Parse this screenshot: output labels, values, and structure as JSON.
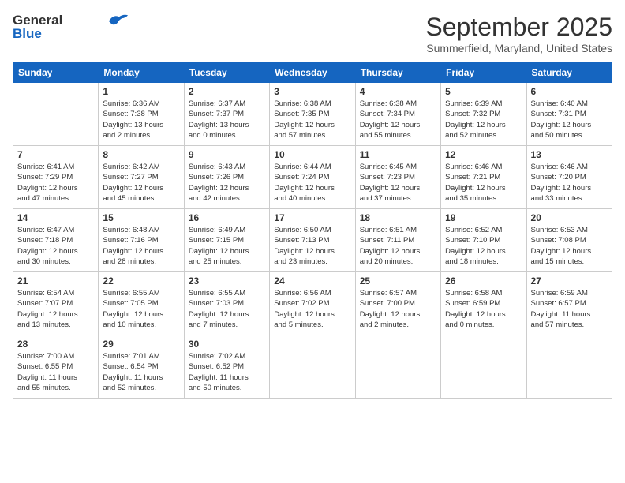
{
  "header": {
    "logo_line1": "General",
    "logo_line2": "Blue",
    "month": "September 2025",
    "location": "Summerfield, Maryland, United States"
  },
  "days_of_week": [
    "Sunday",
    "Monday",
    "Tuesday",
    "Wednesday",
    "Thursday",
    "Friday",
    "Saturday"
  ],
  "weeks": [
    [
      {
        "day": "",
        "info": ""
      },
      {
        "day": "1",
        "info": "Sunrise: 6:36 AM\nSunset: 7:38 PM\nDaylight: 13 hours\nand 2 minutes."
      },
      {
        "day": "2",
        "info": "Sunrise: 6:37 AM\nSunset: 7:37 PM\nDaylight: 13 hours\nand 0 minutes."
      },
      {
        "day": "3",
        "info": "Sunrise: 6:38 AM\nSunset: 7:35 PM\nDaylight: 12 hours\nand 57 minutes."
      },
      {
        "day": "4",
        "info": "Sunrise: 6:38 AM\nSunset: 7:34 PM\nDaylight: 12 hours\nand 55 minutes."
      },
      {
        "day": "5",
        "info": "Sunrise: 6:39 AM\nSunset: 7:32 PM\nDaylight: 12 hours\nand 52 minutes."
      },
      {
        "day": "6",
        "info": "Sunrise: 6:40 AM\nSunset: 7:31 PM\nDaylight: 12 hours\nand 50 minutes."
      }
    ],
    [
      {
        "day": "7",
        "info": "Sunrise: 6:41 AM\nSunset: 7:29 PM\nDaylight: 12 hours\nand 47 minutes."
      },
      {
        "day": "8",
        "info": "Sunrise: 6:42 AM\nSunset: 7:27 PM\nDaylight: 12 hours\nand 45 minutes."
      },
      {
        "day": "9",
        "info": "Sunrise: 6:43 AM\nSunset: 7:26 PM\nDaylight: 12 hours\nand 42 minutes."
      },
      {
        "day": "10",
        "info": "Sunrise: 6:44 AM\nSunset: 7:24 PM\nDaylight: 12 hours\nand 40 minutes."
      },
      {
        "day": "11",
        "info": "Sunrise: 6:45 AM\nSunset: 7:23 PM\nDaylight: 12 hours\nand 37 minutes."
      },
      {
        "day": "12",
        "info": "Sunrise: 6:46 AM\nSunset: 7:21 PM\nDaylight: 12 hours\nand 35 minutes."
      },
      {
        "day": "13",
        "info": "Sunrise: 6:46 AM\nSunset: 7:20 PM\nDaylight: 12 hours\nand 33 minutes."
      }
    ],
    [
      {
        "day": "14",
        "info": "Sunrise: 6:47 AM\nSunset: 7:18 PM\nDaylight: 12 hours\nand 30 minutes."
      },
      {
        "day": "15",
        "info": "Sunrise: 6:48 AM\nSunset: 7:16 PM\nDaylight: 12 hours\nand 28 minutes."
      },
      {
        "day": "16",
        "info": "Sunrise: 6:49 AM\nSunset: 7:15 PM\nDaylight: 12 hours\nand 25 minutes."
      },
      {
        "day": "17",
        "info": "Sunrise: 6:50 AM\nSunset: 7:13 PM\nDaylight: 12 hours\nand 23 minutes."
      },
      {
        "day": "18",
        "info": "Sunrise: 6:51 AM\nSunset: 7:11 PM\nDaylight: 12 hours\nand 20 minutes."
      },
      {
        "day": "19",
        "info": "Sunrise: 6:52 AM\nSunset: 7:10 PM\nDaylight: 12 hours\nand 18 minutes."
      },
      {
        "day": "20",
        "info": "Sunrise: 6:53 AM\nSunset: 7:08 PM\nDaylight: 12 hours\nand 15 minutes."
      }
    ],
    [
      {
        "day": "21",
        "info": "Sunrise: 6:54 AM\nSunset: 7:07 PM\nDaylight: 12 hours\nand 13 minutes."
      },
      {
        "day": "22",
        "info": "Sunrise: 6:55 AM\nSunset: 7:05 PM\nDaylight: 12 hours\nand 10 minutes."
      },
      {
        "day": "23",
        "info": "Sunrise: 6:55 AM\nSunset: 7:03 PM\nDaylight: 12 hours\nand 7 minutes."
      },
      {
        "day": "24",
        "info": "Sunrise: 6:56 AM\nSunset: 7:02 PM\nDaylight: 12 hours\nand 5 minutes."
      },
      {
        "day": "25",
        "info": "Sunrise: 6:57 AM\nSunset: 7:00 PM\nDaylight: 12 hours\nand 2 minutes."
      },
      {
        "day": "26",
        "info": "Sunrise: 6:58 AM\nSunset: 6:59 PM\nDaylight: 12 hours\nand 0 minutes."
      },
      {
        "day": "27",
        "info": "Sunrise: 6:59 AM\nSunset: 6:57 PM\nDaylight: 11 hours\nand 57 minutes."
      }
    ],
    [
      {
        "day": "28",
        "info": "Sunrise: 7:00 AM\nSunset: 6:55 PM\nDaylight: 11 hours\nand 55 minutes."
      },
      {
        "day": "29",
        "info": "Sunrise: 7:01 AM\nSunset: 6:54 PM\nDaylight: 11 hours\nand 52 minutes."
      },
      {
        "day": "30",
        "info": "Sunrise: 7:02 AM\nSunset: 6:52 PM\nDaylight: 11 hours\nand 50 minutes."
      },
      {
        "day": "",
        "info": ""
      },
      {
        "day": "",
        "info": ""
      },
      {
        "day": "",
        "info": ""
      },
      {
        "day": "",
        "info": ""
      }
    ]
  ]
}
